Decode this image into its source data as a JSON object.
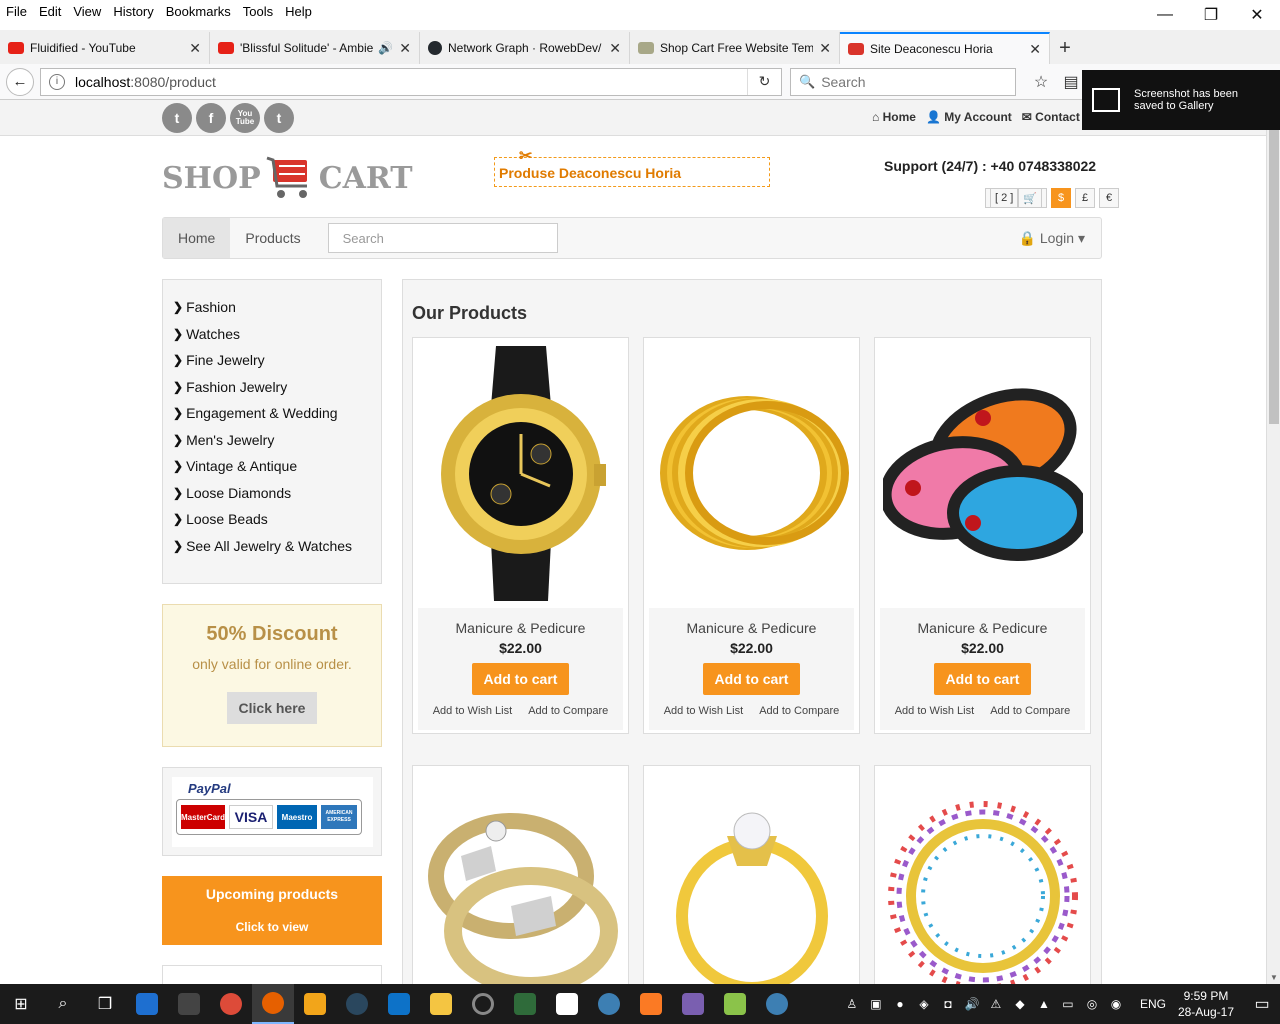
{
  "browser": {
    "menu": [
      "File",
      "Edit",
      "View",
      "History",
      "Bookmarks",
      "Tools",
      "Help"
    ],
    "window_controls": {
      "minimize": "—",
      "restore": "❐",
      "close": "✕"
    },
    "tabs": [
      {
        "label": "Fluidified - YouTube",
        "icon_color": "#e62117",
        "active": false
      },
      {
        "label": "'Blissful Solitude' - Ambie",
        "icon_color": "#e62117",
        "active": false
      },
      {
        "label": "Network Graph · RowebDev/",
        "icon_color": "#24292e",
        "active": false
      },
      {
        "label": "Shop Cart Free Website Tem",
        "icon_color": "#8a8a6a",
        "active": false
      },
      {
        "label": "Site Deaconescu Horia",
        "icon_color": "#d9342b",
        "active": true
      }
    ],
    "new_tab": "+",
    "url_host": "localhost",
    "url_path": ":8080/product",
    "search_placeholder": "Search",
    "toast": "Screenshot has been saved to Gallery"
  },
  "site": {
    "social": [
      "t",
      "f",
      "You Tube",
      "t"
    ],
    "top_links": [
      "Home",
      "My Account",
      "Contact"
    ],
    "logo_left": "SHOP",
    "logo_right": "CART",
    "promo_text": "Produse Deaconescu Horia",
    "support": "Support (24/7) : +40 0748338022",
    "cart_count": "[ 2 ]",
    "currencies": [
      "$",
      "£",
      "€"
    ],
    "active_currency": "$",
    "nav": {
      "home": "Home",
      "products": "Products",
      "search_placeholder": "Search",
      "login": "Login"
    },
    "categories": [
      "Fashion",
      "Watches",
      "Fine Jewelry",
      "Fashion Jewelry",
      "Engagement & Wedding",
      "Men's Jewelry",
      "Vintage & Antique",
      "Loose Diamonds",
      "Loose Beads",
      "See All Jewelry & Watches"
    ],
    "discount": {
      "title": "50% Discount",
      "subtitle": "only valid for online order.",
      "button": "Click here"
    },
    "payment": {
      "paypal": "PayPal",
      "cards": [
        "MasterCard",
        "VISA",
        "Maestro",
        "AMERICAN EXPRESS"
      ]
    },
    "upcoming": {
      "title": "Upcoming products",
      "subtitle": "Click to view"
    },
    "products_title": "Our Products",
    "products": [
      {
        "name": "Manicure & Pedicure",
        "price": "$22.00",
        "add": "Add to cart",
        "wish": "Add to Wish List",
        "compare": "Add to Compare",
        "image": "gold-watch"
      },
      {
        "name": "Manicure & Pedicure",
        "price": "$22.00",
        "add": "Add to cart",
        "wish": "Add to Wish List",
        "compare": "Add to Compare",
        "image": "gold-bangles"
      },
      {
        "name": "Manicure & Pedicure",
        "price": "$22.00",
        "add": "Add to cart",
        "wish": "Add to Wish List",
        "compare": "Add to Compare",
        "image": "medical-wristbands"
      },
      {
        "name": "",
        "price": "",
        "add": "",
        "wish": "",
        "compare": "",
        "image": "wedding-rings"
      },
      {
        "name": "",
        "price": "",
        "add": "",
        "wish": "",
        "compare": "",
        "image": "diamond-ring"
      },
      {
        "name": "",
        "price": "",
        "add": "",
        "wish": "",
        "compare": "",
        "image": "beaded-necklace"
      }
    ]
  },
  "taskbar": {
    "language": "ENG",
    "time": "9:59 PM",
    "date": "28-Aug-17"
  }
}
